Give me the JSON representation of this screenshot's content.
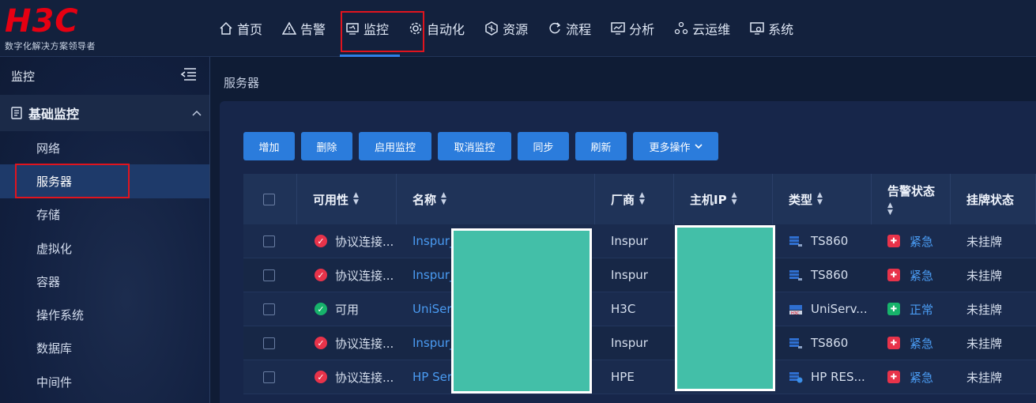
{
  "brand": {
    "logo": "H3C",
    "tagline": "数字化解决方案领导者",
    "color": "#e60012"
  },
  "nav": [
    {
      "label": "首页",
      "icon": "home-icon"
    },
    {
      "label": "告警",
      "icon": "warning-icon"
    },
    {
      "label": "监控",
      "icon": "monitor-icon",
      "active": true
    },
    {
      "label": "自动化",
      "icon": "gear-icon"
    },
    {
      "label": "资源",
      "icon": "resource-icon"
    },
    {
      "label": "流程",
      "icon": "process-icon"
    },
    {
      "label": "分析",
      "icon": "analytics-icon"
    },
    {
      "label": "云运维",
      "icon": "cloud-ops-icon"
    },
    {
      "label": "系统",
      "icon": "system-icon"
    }
  ],
  "sidebar": {
    "title": "监控",
    "group": "基础监控",
    "items": [
      {
        "label": "网络"
      },
      {
        "label": "服务器",
        "active": true
      },
      {
        "label": "存储"
      },
      {
        "label": "虚拟化"
      },
      {
        "label": "容器"
      },
      {
        "label": "操作系统"
      },
      {
        "label": "数据库"
      },
      {
        "label": "中间件"
      }
    ]
  },
  "breadcrumb": "服务器",
  "toolbar": {
    "add": "增加",
    "delete": "删除",
    "enable": "启用监控",
    "cancel": "取消监控",
    "sync": "同步",
    "refresh": "刷新",
    "more": "更多操作"
  },
  "table": {
    "headers": {
      "availability": "可用性",
      "name": "名称",
      "vendor": "厂商",
      "host_ip": "主机IP",
      "type": "类型",
      "alarm": "告警状态",
      "tag": "挂牌状态"
    },
    "rows": [
      {
        "availability": "协议连接...",
        "status": "red",
        "name": "Inspur_",
        "vendor": "Inspur",
        "type": "TS860",
        "alarm": "紧急",
        "alarm_level": "red",
        "tag": "未挂牌"
      },
      {
        "availability": "协议连接...",
        "status": "red",
        "name": "Inspur_",
        "vendor": "Inspur",
        "type": "TS860",
        "alarm": "紧急",
        "alarm_level": "red",
        "tag": "未挂牌"
      },
      {
        "availability": "可用",
        "status": "green",
        "name": "UniSer",
        "vendor": "H3C",
        "type": "UniServ...",
        "alarm": "正常",
        "alarm_level": "green",
        "tag": "未挂牌"
      },
      {
        "availability": "协议连接...",
        "status": "red",
        "name": "Inspur_",
        "vendor": "Inspur",
        "type": "TS860",
        "alarm": "紧急",
        "alarm_level": "red",
        "tag": "未挂牌"
      },
      {
        "availability": "协议连接...",
        "status": "red",
        "name": "HP Ser",
        "vendor": "HPE",
        "type": "HP RES...",
        "alarm": "紧急",
        "alarm_level": "red",
        "tag": "未挂牌"
      }
    ]
  }
}
